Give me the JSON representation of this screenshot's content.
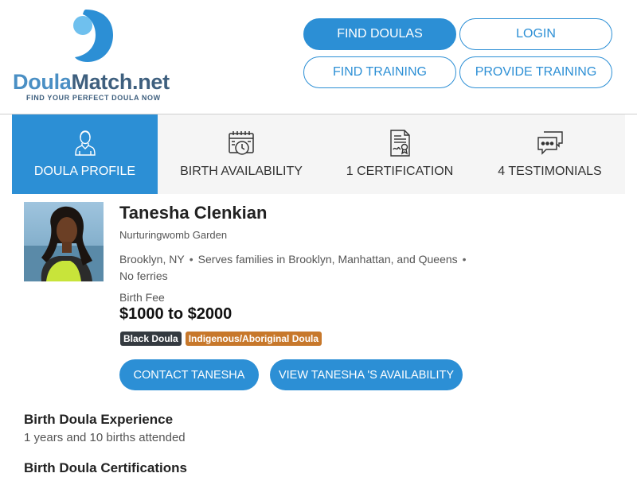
{
  "brand": {
    "name_part1": "Doula",
    "name_part2": "Match.net",
    "tagline": "FIND YOUR PERFECT DOULA NOW",
    "colors": {
      "accent": "#2c8fd5",
      "logo_light": "#4a8fc4",
      "logo_dark": "#3e5f7e"
    }
  },
  "nav": {
    "find_doulas": "FIND DOULAS",
    "login": "LOGIN",
    "find_training": "FIND TRAINING",
    "provide_training": "PROVIDE TRAINING"
  },
  "tabs": [
    {
      "label": "DOULA PROFILE",
      "icon": "doula-person-icon",
      "active": true
    },
    {
      "label": "BIRTH AVAILABILITY",
      "icon": "calendar-clock-icon",
      "active": false
    },
    {
      "label": "1 CERTIFICATION",
      "icon": "certificate-icon",
      "active": false
    },
    {
      "label": "4 TESTIMONIALS",
      "icon": "chat-bubbles-icon",
      "active": false
    }
  ],
  "profile": {
    "name": "Tanesha Clenkian",
    "organization": "Nurturingwomb Garden",
    "location": "Brooklyn, NY",
    "service_area": "Serves families in Brooklyn, Manhattan, and Queens",
    "ferries": "No ferries",
    "fee_label": "Birth Fee",
    "fee": "$1000 to $2000",
    "badges": [
      {
        "label": "Black Doula",
        "color": "#343a40"
      },
      {
        "label": "Indigenous/Aboriginal Doula",
        "color": "#c7782b"
      }
    ],
    "contact_button": "CONTACT TANESHA",
    "availability_button": "VIEW TANESHA 'S AVAILABILITY"
  },
  "sections": {
    "experience_title": "Birth Doula Experience",
    "experience_body": "1 years and 10 births attended",
    "certifications_title": "Birth Doula Certifications"
  }
}
